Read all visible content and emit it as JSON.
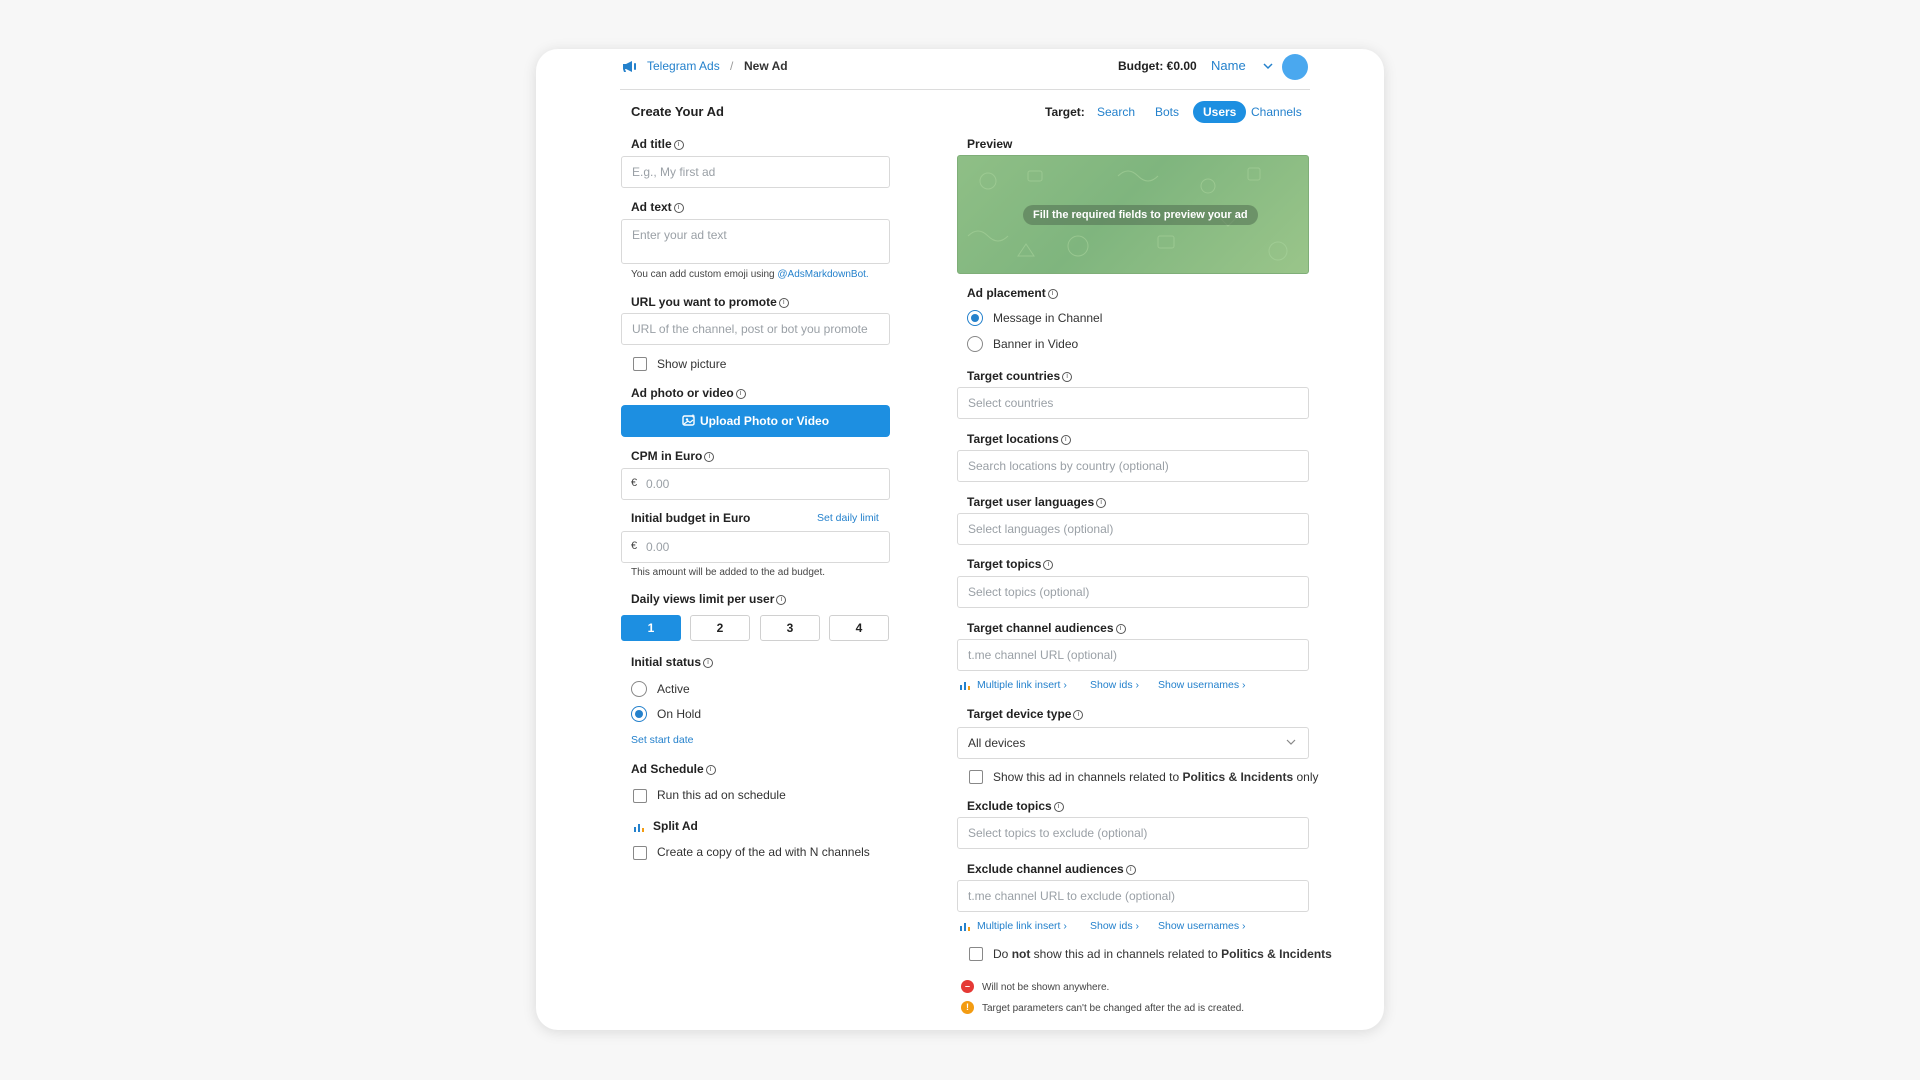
{
  "header": {
    "app_name": "Telegram Ads",
    "separator": "/",
    "page_name": "New Ad",
    "budget_label": "Budget: €0.00",
    "user_name": "Name"
  },
  "form": {
    "title": "Create Your Ad",
    "target_label": "Target:",
    "target_tabs": [
      {
        "label": "Search",
        "active": false
      },
      {
        "label": "Bots",
        "active": false
      },
      {
        "label": "Users",
        "active": true
      },
      {
        "label": "Channels",
        "active": false
      }
    ],
    "ad_title": {
      "label": "Ad title",
      "placeholder": "E.g., My first ad",
      "value": ""
    },
    "ad_text": {
      "label": "Ad text",
      "placeholder": "Enter your ad text",
      "value": "",
      "hint": "You can add custom emoji using",
      "hint_link": "@AdsMarkdownBot."
    },
    "url": {
      "label": "URL you want to promote",
      "placeholder": "URL of the channel, post or bot you promote",
      "value": ""
    },
    "show_picture": {
      "label": "Show picture",
      "checked": false
    },
    "ad_photo": {
      "label": "Ad photo or video",
      "button": "Upload Photo or Video"
    },
    "cpm": {
      "label": "CPM in Euro",
      "currency": "€",
      "placeholder": "0.00"
    },
    "budget": {
      "label": "Initial budget in Euro",
      "link": "Set daily limit",
      "currency": "€",
      "placeholder": "0.00",
      "hint": "This amount will be added to the ad budget."
    },
    "daily_views": {
      "label": "Daily views limit per user",
      "options": [
        "1",
        "2",
        "3",
        "4"
      ],
      "selected": "1"
    },
    "initial_status": {
      "label": "Initial status",
      "options": [
        "Active",
        "On Hold"
      ],
      "selected": "On Hold",
      "link": "Set start date"
    },
    "schedule": {
      "label": "Ad Schedule",
      "checkbox": "Run this ad on schedule",
      "checked": false
    },
    "split": {
      "label": "Split Ad",
      "checkbox": "Create a copy of the ad with N channels",
      "checked": false
    }
  },
  "right": {
    "preview": {
      "label": "Preview",
      "placeholder": "Fill the required fields to preview your ad"
    },
    "placement": {
      "label": "Ad placement",
      "options": [
        "Message in Channel",
        "Banner in Video"
      ],
      "selected": "Message in Channel"
    },
    "countries": {
      "label": "Target countries",
      "placeholder": "Select countries"
    },
    "locations": {
      "label": "Target locations",
      "placeholder": "Search locations by country (optional)"
    },
    "languages": {
      "label": "Target user languages",
      "placeholder": "Select languages (optional)"
    },
    "topics": {
      "label": "Target topics",
      "placeholder": "Select topics (optional)"
    },
    "channel_audiences": {
      "label": "Target channel audiences",
      "placeholder": "t.me channel URL (optional)"
    },
    "links": [
      "Multiple link insert ›",
      "Show ids ›",
      "Show usernames ›"
    ],
    "device": {
      "label": "Target device type",
      "value": "All devices"
    },
    "politics_only": {
      "pre": "Show this ad in channels related to ",
      "bold": "Politics & Incidents",
      "post": " only",
      "checked": false
    },
    "exclude_topics": {
      "label": "Exclude topics",
      "placeholder": "Select topics to exclude (optional)"
    },
    "exclude_audiences": {
      "label": "Exclude channel audiences",
      "placeholder": "t.me channel URL to exclude (optional)"
    },
    "no_politics": {
      "pre": "Do ",
      "bold1": "not",
      "mid": " show this ad in channels related to ",
      "bold2": "Politics & Incidents",
      "checked": false
    },
    "warnings": [
      {
        "text": "Will not be shown anywhere.",
        "color": "#e53935",
        "icon": "–"
      },
      {
        "text": "Target parameters can't be changed after the ad is created.",
        "color": "#f39c12",
        "icon": "!"
      }
    ]
  },
  "colors": {
    "accent": "#1d8fe1",
    "link": "#2481cc"
  }
}
